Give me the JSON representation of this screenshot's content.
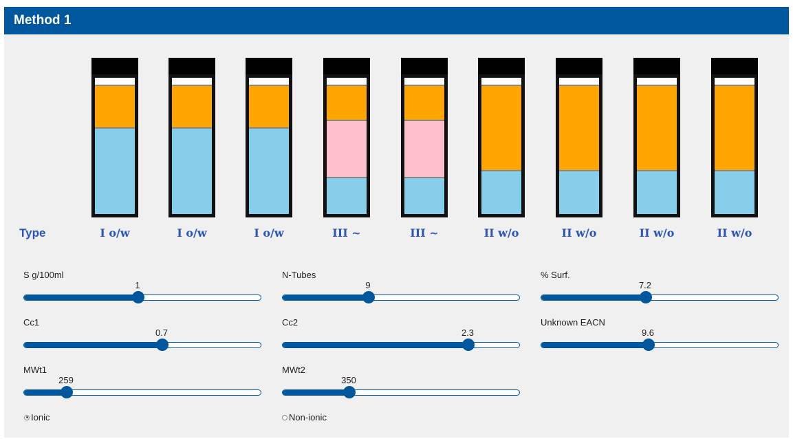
{
  "panel": {
    "title": "Method 1"
  },
  "type_label": "Type",
  "tubes": [
    {
      "label": "I o/w",
      "oil": 0.33,
      "mid": 0.0,
      "water": 0.67
    },
    {
      "label": "I o/w",
      "oil": 0.33,
      "mid": 0.0,
      "water": 0.67
    },
    {
      "label": "I o/w",
      "oil": 0.33,
      "mid": 0.0,
      "water": 0.67
    },
    {
      "label": "III ~",
      "oil": 0.27,
      "mid": 0.44,
      "water": 0.29
    },
    {
      "label": "III ~",
      "oil": 0.27,
      "mid": 0.44,
      "water": 0.29
    },
    {
      "label": "II w/o",
      "oil": 0.66,
      "mid": 0.0,
      "water": 0.34
    },
    {
      "label": "II w/o",
      "oil": 0.66,
      "mid": 0.0,
      "water": 0.34
    },
    {
      "label": "II w/o",
      "oil": 0.66,
      "mid": 0.0,
      "water": 0.34
    },
    {
      "label": "II w/o",
      "oil": 0.66,
      "mid": 0.0,
      "water": 0.34
    }
  ],
  "sliders": [
    {
      "label": "S g/100ml",
      "value": "1",
      "fraction": 0.48
    },
    {
      "label": "N-Tubes",
      "value": "9",
      "fraction": 0.36
    },
    {
      "label": "% Surf.",
      "value": "7.2",
      "fraction": 0.44
    },
    {
      "label": "Cc1",
      "value": "0.7",
      "fraction": 0.58
    },
    {
      "label": "Cc2",
      "value": "2.3",
      "fraction": 0.78
    },
    {
      "label": "Unknown EACN",
      "value": "9.6",
      "fraction": 0.45
    },
    {
      "label": "MWt1",
      "value": "259",
      "fraction": 0.18
    },
    {
      "label": "MWt2",
      "value": "350",
      "fraction": 0.28
    }
  ],
  "radios": [
    {
      "label": "Ionic",
      "checked": true
    },
    {
      "label": "Non-ionic",
      "checked": false
    }
  ],
  "colors": {
    "accent": "#00579e",
    "oil": "#ffa500",
    "middle": "#ffc0cb",
    "water": "#87ceeb",
    "label": "#2a55b8"
  }
}
